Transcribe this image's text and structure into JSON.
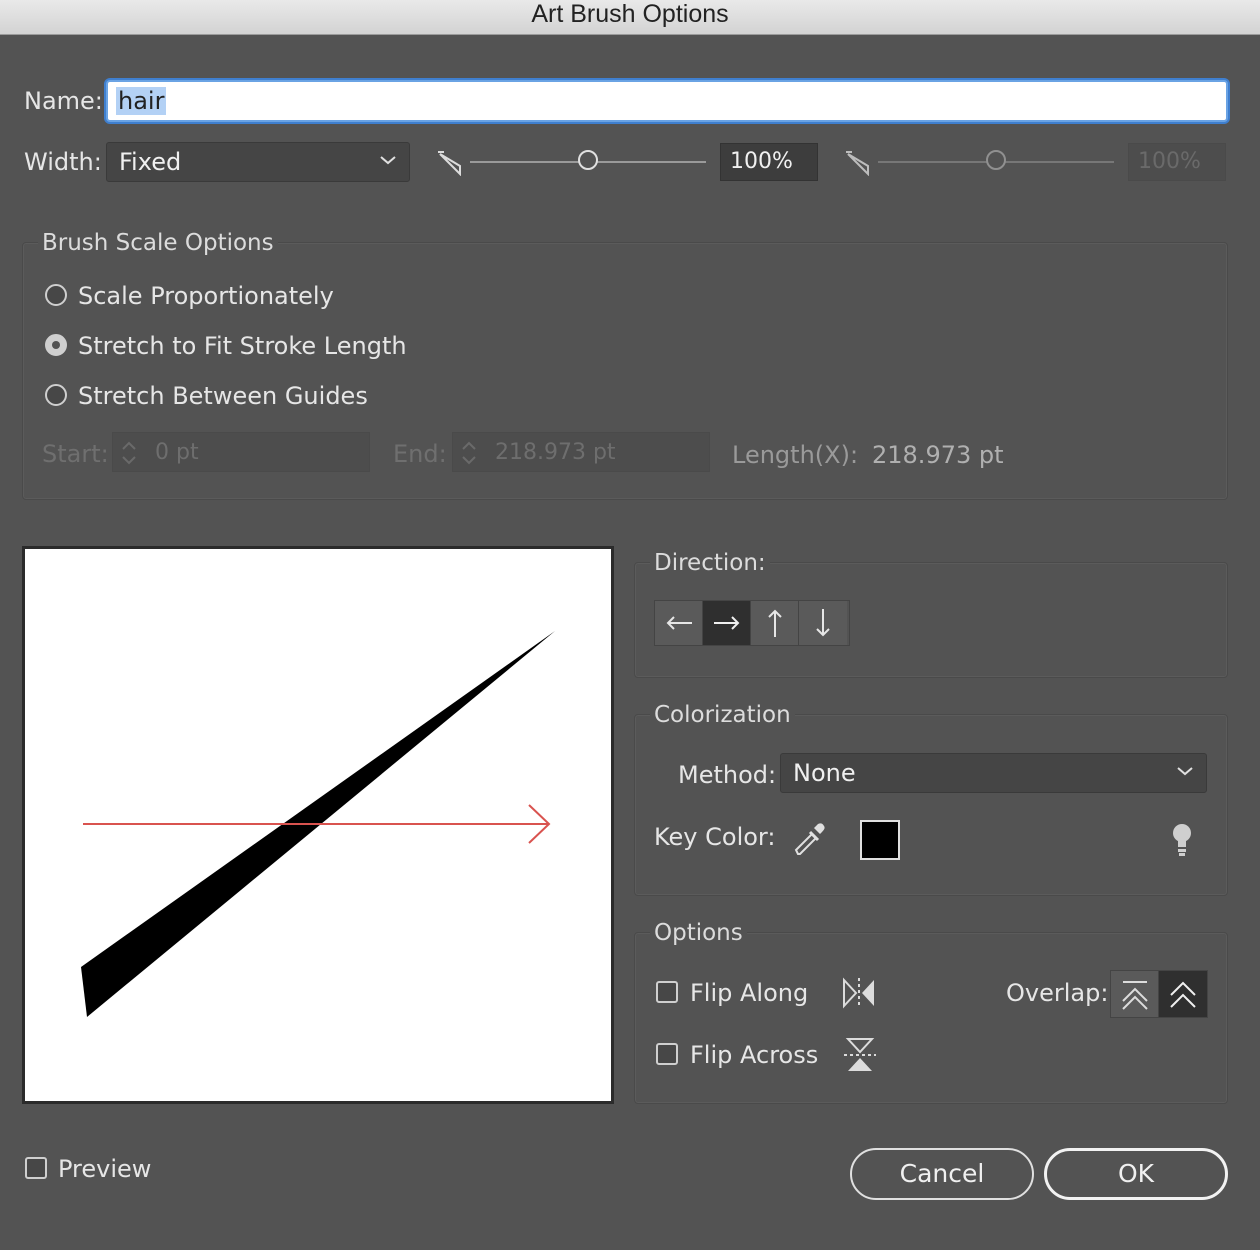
{
  "window": {
    "title": "Art Brush Options"
  },
  "name_field": {
    "label": "Name:",
    "value": "hair"
  },
  "width": {
    "label": "Width:",
    "selected": "Fixed",
    "value_primary": "100%",
    "value_secondary": "100%",
    "slider_primary_level": 0.5,
    "slider_secondary_level": 0.5
  },
  "scale_options": {
    "title": "Brush Scale Options",
    "options": [
      "Scale Proportionately",
      "Stretch to Fit Stroke Length",
      "Stretch Between Guides"
    ],
    "selected_index": 1,
    "start_label": "Start:",
    "start_value": "0 pt",
    "end_label": "End:",
    "end_value": "218.973 pt",
    "length_label": "Length(X):",
    "length_value": "218.973 pt"
  },
  "direction": {
    "title": "Direction:",
    "selected": "right"
  },
  "colorization": {
    "title": "Colorization",
    "method_label": "Method:",
    "method_value": "None",
    "key_color_label": "Key Color:",
    "key_color": "#000000"
  },
  "options": {
    "title": "Options",
    "flip_along": "Flip Along",
    "flip_across": "Flip Across",
    "overlap_label": "Overlap:"
  },
  "footer": {
    "preview_label": "Preview",
    "cancel_label": "Cancel",
    "ok_label": "OK"
  },
  "colors": {
    "accent": "#3f7fcf",
    "arrow": "#d9534f",
    "background": "#535353"
  }
}
